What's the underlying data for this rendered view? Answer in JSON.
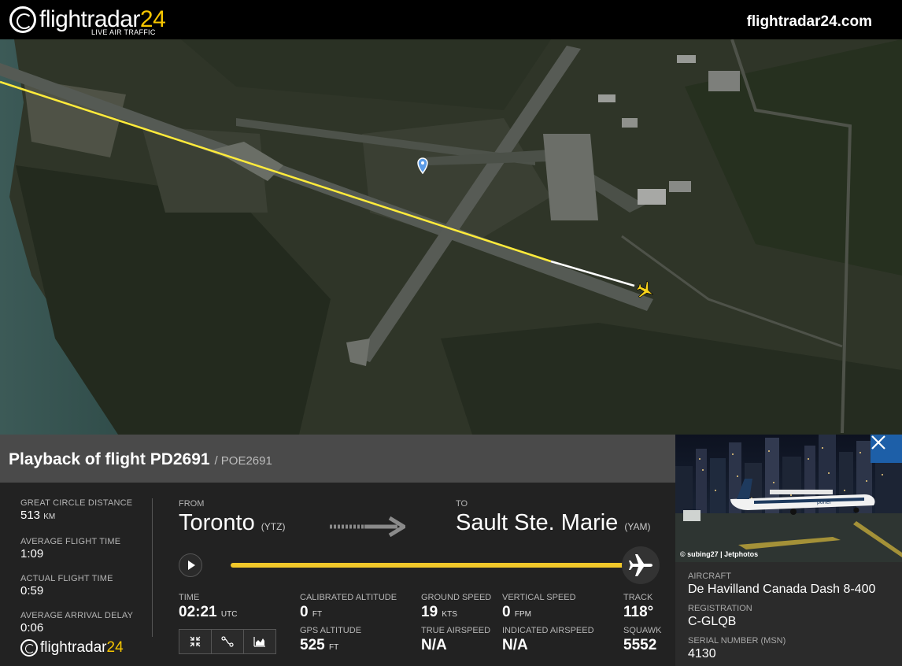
{
  "header": {
    "logo_text_main": "flightradar",
    "logo_text_num": "24",
    "logo_sub": "LIVE AIR TRAFFIC",
    "site_url": "flightradar24.com"
  },
  "map": {
    "track_color": "#ffeb3b",
    "track_recent_color": "#ffffff",
    "marker_icon": "location-pin-icon",
    "aircraft_icon": "airplane-icon"
  },
  "flight": {
    "title": "Playback of flight PD2691",
    "callsign": "/ POE2691",
    "from_label": "FROM",
    "from_city": "Toronto",
    "from_code": "(YTZ)",
    "to_label": "TO",
    "to_city": "Sault Ste. Marie",
    "to_code": "(YAM)",
    "progress_fraction": 1.0
  },
  "stats": [
    {
      "label": "GREAT CIRCLE DISTANCE",
      "value": "513",
      "unit": "KM"
    },
    {
      "label": "AVERAGE FLIGHT TIME",
      "value": "1:09",
      "unit": ""
    },
    {
      "label": "ACTUAL FLIGHT TIME",
      "value": "0:59",
      "unit": ""
    },
    {
      "label": "AVERAGE ARRIVAL DELAY",
      "value": "0:06",
      "unit": ""
    }
  ],
  "metrics": {
    "time": {
      "label": "TIME",
      "value": "02:21",
      "unit": "UTC"
    },
    "calibrated_altitude": {
      "label": "CALIBRATED ALTITUDE",
      "value": "0",
      "unit": "FT"
    },
    "gps_altitude": {
      "label": "GPS ALTITUDE",
      "value": "525",
      "unit": "FT"
    },
    "ground_speed": {
      "label": "GROUND SPEED",
      "value": "19",
      "unit": "KTS"
    },
    "true_airspeed": {
      "label": "TRUE AIRSPEED",
      "value": "N/A"
    },
    "vertical_speed": {
      "label": "VERTICAL SPEED",
      "value": "0",
      "unit": "FPM"
    },
    "indicated_airspeed": {
      "label": "INDICATED AIRSPEED",
      "value": "N/A"
    },
    "track": {
      "label": "TRACK",
      "value": "118°"
    },
    "squawk": {
      "label": "SQUAWK",
      "value": "5552"
    }
  },
  "footer": {
    "logo_text_main": "flightradar",
    "logo_text_num": "24"
  },
  "aircraft": {
    "photo_credit": "© subing27 | Jetphotos",
    "aircraft_label": "AIRCRAFT",
    "aircraft_value": "De Havilland Canada Dash 8-400",
    "registration_label": "REGISTRATION",
    "registration_value": "C-GLQB",
    "serial_label": "SERIAL NUMBER (MSN)",
    "serial_value": "4130",
    "livery_text": "porter"
  },
  "colors": {
    "accent_yellow": "#f2c82a",
    "close_blue": "#1d5fa8"
  }
}
